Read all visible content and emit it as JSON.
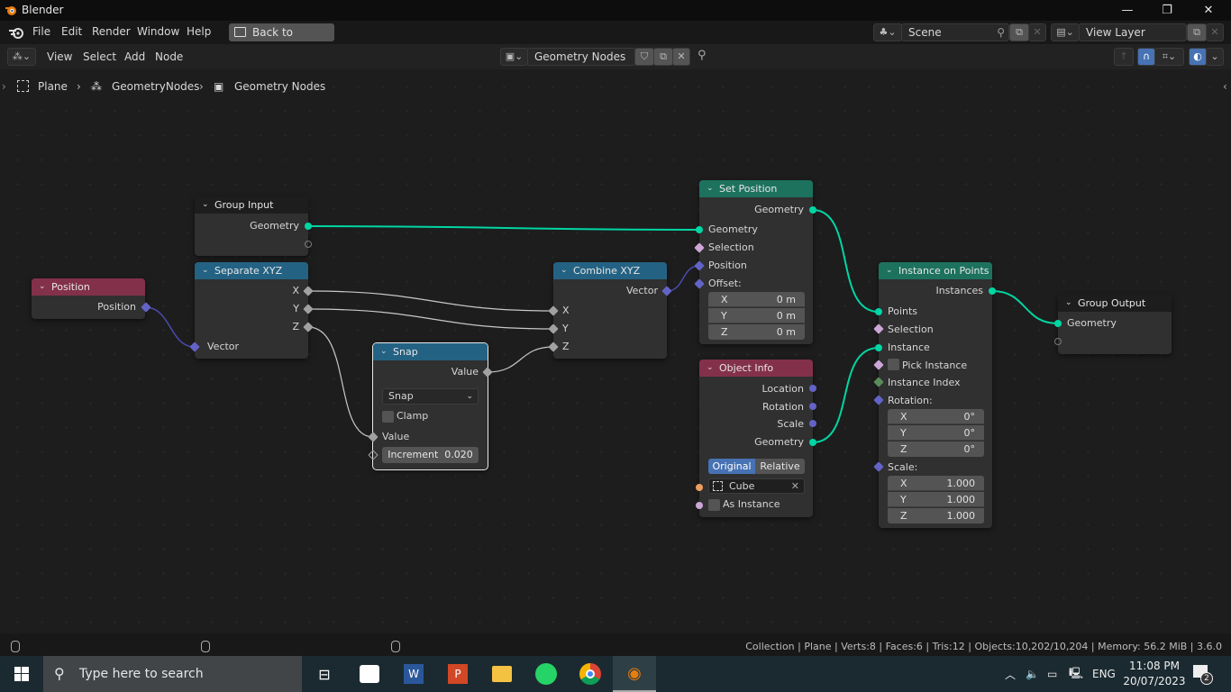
{
  "window": {
    "title": "Blender",
    "controls": {
      "minimize": "—",
      "maximize": "❐",
      "close": "✕"
    }
  },
  "menubar": {
    "items": [
      "File",
      "Edit",
      "Render",
      "Window",
      "Help"
    ],
    "back_button": "Back to Previous",
    "scene": {
      "label": "Scene"
    },
    "view_layer": {
      "label": "View Layer"
    }
  },
  "header": {
    "menus": [
      "View",
      "Select",
      "Add",
      "Node"
    ],
    "node_tree_name": "Geometry Nodes"
  },
  "breadcrumb": {
    "items": [
      "Plane",
      "GeometryNodes",
      "Geometry Nodes"
    ]
  },
  "nodes": {
    "group_input": {
      "title": "Group Input",
      "outputs": [
        "Geometry"
      ]
    },
    "position": {
      "title": "Position",
      "outputs": [
        "Position"
      ]
    },
    "separate_xyz": {
      "title": "Separate XYZ",
      "outputs": [
        "X",
        "Y",
        "Z"
      ],
      "inputs": [
        "Vector"
      ]
    },
    "snap": {
      "title": "Snap",
      "outputs": [
        "Value"
      ],
      "operation": "Snap",
      "clamp_label": "Clamp",
      "clamp_checked": false,
      "inputs": [
        "Value"
      ],
      "increment_label": "Increment",
      "increment_value": "0.020"
    },
    "combine_xyz": {
      "title": "Combine XYZ",
      "outputs": [
        "Vector"
      ],
      "inputs": [
        "X",
        "Y",
        "Z"
      ]
    },
    "set_position": {
      "title": "Set Position",
      "outputs": [
        "Geometry"
      ],
      "inputs": [
        "Geometry",
        "Selection",
        "Position",
        "Offset:"
      ],
      "offset": [
        {
          "axis": "X",
          "value": "0 m"
        },
        {
          "axis": "Y",
          "value": "0 m"
        },
        {
          "axis": "Z",
          "value": "0 m"
        }
      ]
    },
    "object_info": {
      "title": "Object Info",
      "outputs": [
        "Location",
        "Rotation",
        "Scale",
        "Geometry"
      ],
      "transform_space": {
        "options": [
          "Original",
          "Relative"
        ],
        "selected": "Original"
      },
      "object": "Cube",
      "as_instance_label": "As Instance",
      "as_instance_checked": false
    },
    "instance_on_points": {
      "title": "Instance on Points",
      "outputs": [
        "Instances"
      ],
      "inputs": [
        "Points",
        "Selection",
        "Instance",
        "Pick Instance",
        "Instance Index",
        "Rotation:",
        "Scale:"
      ],
      "pick_instance_checked": false,
      "rotation": [
        {
          "axis": "X",
          "value": "0°"
        },
        {
          "axis": "Y",
          "value": "0°"
        },
        {
          "axis": "Z",
          "value": "0°"
        }
      ],
      "scale": [
        {
          "axis": "X",
          "value": "1.000"
        },
        {
          "axis": "Y",
          "value": "1.000"
        },
        {
          "axis": "Z",
          "value": "1.000"
        }
      ]
    },
    "group_output": {
      "title": "Group Output",
      "inputs": [
        "Geometry"
      ]
    }
  },
  "statusbar": {
    "stats": "Collection | Plane | Verts:8 | Faces:6 | Tris:12 | Objects:10,202/10,204 | Memory: 56.2 MiB | 3.6.0"
  },
  "taskbar": {
    "search_placeholder": "Type here to search",
    "language": "ENG",
    "time": "11:08 PM",
    "date": "20/07/2023",
    "notifications": "2"
  },
  "colors": {
    "geometry_socket": "#00d6a3",
    "vector_socket": "#6363c7",
    "float_socket": "#a1a1a1",
    "geometry_header": "#1d725e",
    "converter_header": "#246283",
    "input_header": "#83314a",
    "accent_blue": "#4772b3"
  }
}
